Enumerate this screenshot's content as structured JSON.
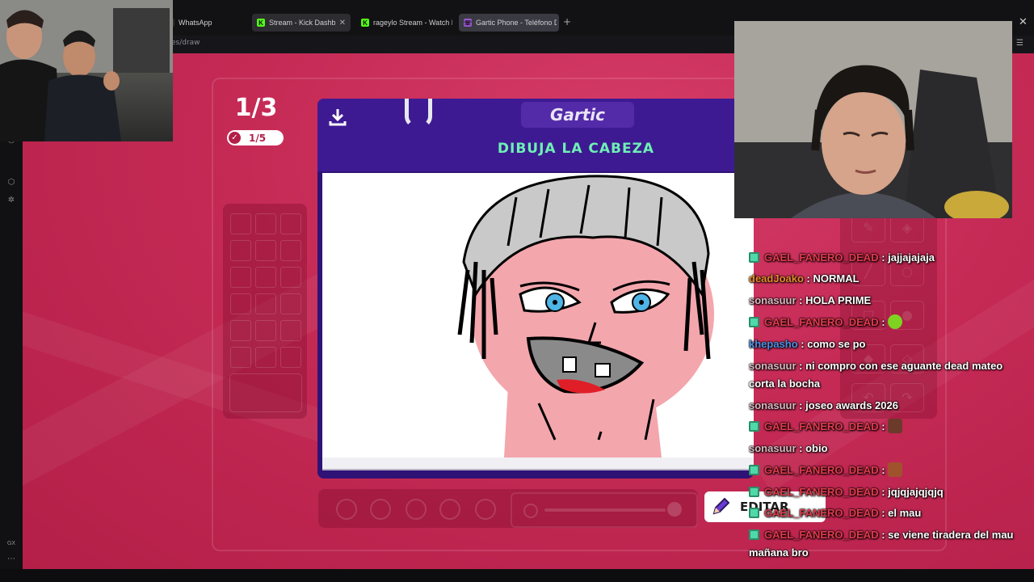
{
  "browser": {
    "tabs": [
      {
        "label": "WhatsApp",
        "icon": "whatsapp-icon"
      },
      {
        "label": "Stream - Kick Dashbo",
        "icon": "kick-icon",
        "closable": true,
        "active": true
      },
      {
        "label": "rageylo Stream - Watch L",
        "icon": "kick-icon"
      },
      {
        "label": "Gartic Phone - Teléfono D",
        "icon": "gartic-icon"
      }
    ],
    "address_fragment": "es/draw",
    "sidebar_label": "GX"
  },
  "game": {
    "round": "1/3",
    "progress": "1/5",
    "logo": "Gartic",
    "instruction": "DIBUJA LA CABEZA",
    "edit_button": "EDITAR",
    "colors": {
      "accent": "#6ef0b5",
      "background": "#c52a55",
      "card": "#3e1a92"
    }
  },
  "chat": {
    "messages": [
      {
        "user": "GAEL_FANERO_DEAD",
        "color": "#e23b4c",
        "badge": true,
        "text": "jajjajajaja"
      },
      {
        "user": "deadJoako",
        "color": "#e88a2c",
        "badge": false,
        "text": "NORMAL"
      },
      {
        "user": "sonasuur",
        "color": "#d9b9c0",
        "badge": false,
        "text": "HOLA PRIME"
      },
      {
        "user": "GAEL_FANERO_DEAD",
        "color": "#e23b4c",
        "badge": true,
        "text": "",
        "emote": "#7ed321"
      },
      {
        "user": "khepasho",
        "color": "#4a90e2",
        "badge": false,
        "text": "como se po"
      },
      {
        "user": "sonasuur",
        "color": "#d9b9c0",
        "badge": false,
        "text": "ni compro con ese aguante dead mateo corta la bocha"
      },
      {
        "user": "sonasuur",
        "color": "#d9b9c0",
        "badge": false,
        "text": "joseo awards 2026"
      },
      {
        "user": "GAEL_FANERO_DEAD",
        "color": "#e23b4c",
        "badge": true,
        "text": "",
        "emote": "#6b3a2a"
      },
      {
        "user": "sonasuur",
        "color": "#d9b9c0",
        "badge": false,
        "text": "obio"
      },
      {
        "user": "GAEL_FANERO_DEAD",
        "color": "#e23b4c",
        "badge": true,
        "text": "",
        "emote": "#a0522d"
      },
      {
        "user": "GAEL_FANERO_DEAD",
        "color": "#e23b4c",
        "badge": true,
        "text": "jqjqjajqjqjq"
      },
      {
        "user": "GAEL_FANERO_DEAD",
        "color": "#e23b4c",
        "badge": true,
        "text": "el mau"
      },
      {
        "user": "GAEL_FANERO_DEAD",
        "color": "#e23b4c",
        "badge": true,
        "text": "se viene tiradera del mau mañana bro"
      }
    ]
  }
}
